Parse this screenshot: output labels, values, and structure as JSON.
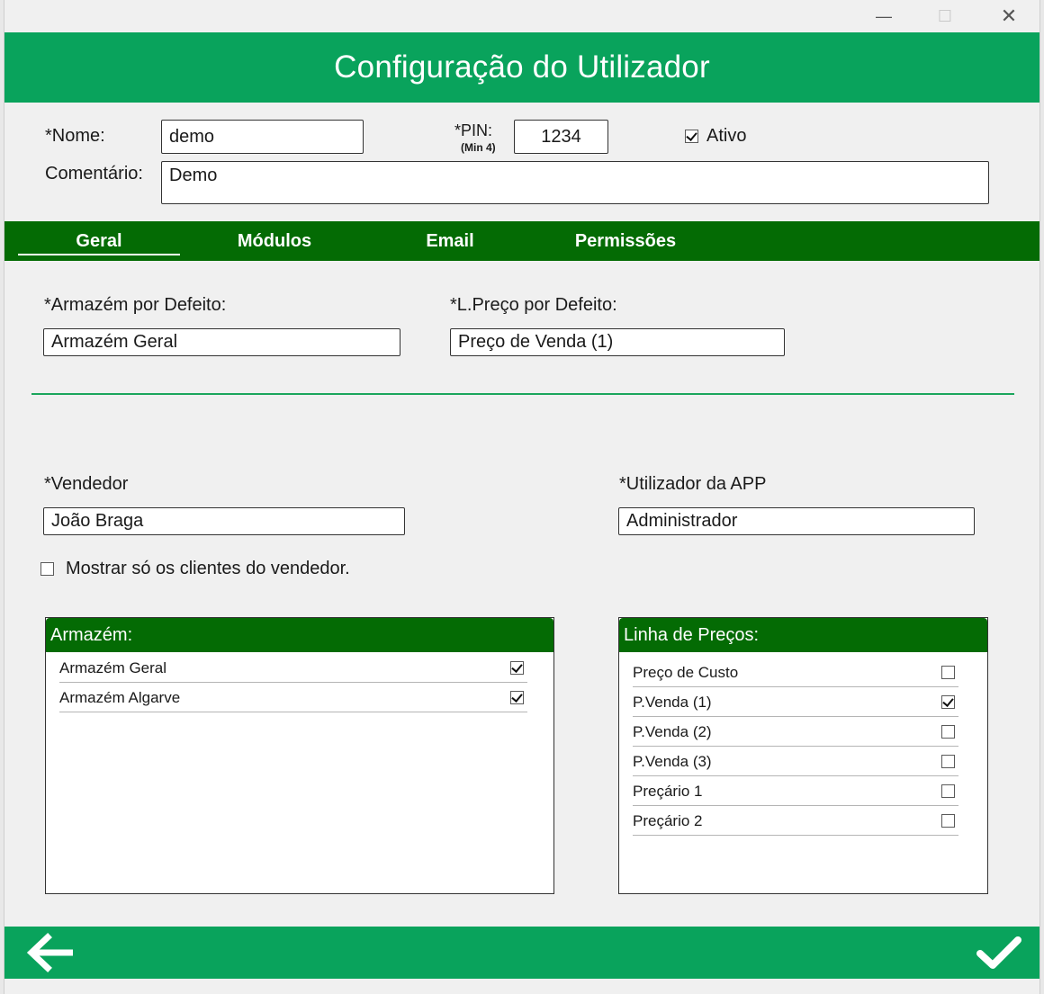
{
  "window": {
    "controls": {
      "minimize": "—",
      "maximize": "☐",
      "close": "✕"
    }
  },
  "header": {
    "title": "Configuração do Utilizador"
  },
  "form": {
    "name_label": "*Nome:",
    "name_value": "demo",
    "pin_label": "*PIN:",
    "pin_hint": "(Min 4)",
    "pin_value": "1234",
    "active_label": "Ativo",
    "active_checked": true,
    "comment_label": "Comentário:",
    "comment_value": "Demo"
  },
  "tabs": [
    {
      "label": "Geral",
      "active": true
    },
    {
      "label": "Módulos",
      "active": false
    },
    {
      "label": "Email",
      "active": false
    },
    {
      "label": "Permissões",
      "active": false
    }
  ],
  "general": {
    "warehouse_label": "*Armazém por Defeito:",
    "warehouse_value": "Armazém Geral",
    "pricelist_label": "*L.Preço por Defeito:",
    "pricelist_value": "Preço de Venda (1)",
    "seller_label": "*Vendedor",
    "seller_value": "João Braga",
    "app_user_label": "*Utilizador da APP",
    "app_user_value": "Administrador",
    "only_seller_clients_label": "Mostrar só os clientes do vendedor.",
    "only_seller_clients_checked": false
  },
  "warehouse_panel": {
    "title": "Armazém:",
    "items": [
      {
        "label": "Armazém Geral",
        "checked": true
      },
      {
        "label": "Armazém Algarve",
        "checked": true
      }
    ]
  },
  "price_panel": {
    "title": "Linha de Preços:",
    "items": [
      {
        "label": "Preço de Custo",
        "checked": false
      },
      {
        "label": "P.Venda (1)",
        "checked": true
      },
      {
        "label": "P.Venda (2)",
        "checked": false
      },
      {
        "label": "P.Venda (3)",
        "checked": false
      },
      {
        "label": "Preçário 1",
        "checked": false
      },
      {
        "label": "Preçário 2",
        "checked": false
      }
    ]
  },
  "footer": {
    "back_icon": "arrow-left-icon",
    "confirm_icon": "checkmark-icon"
  },
  "colors": {
    "header_green": "#09a35c",
    "tab_dark_green": "#046b04"
  }
}
